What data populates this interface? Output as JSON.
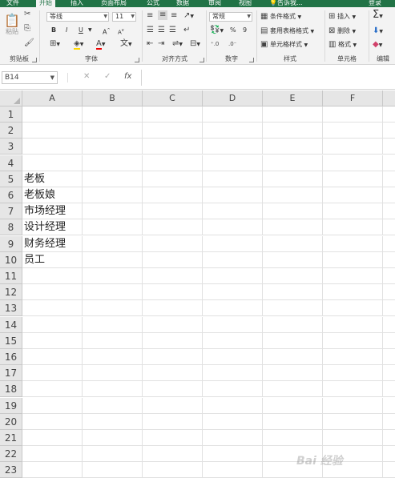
{
  "tabs": [
    "文件",
    "开始",
    "插入",
    "页面布局",
    "公式",
    "数据",
    "审阅",
    "视图",
    "告诉我...",
    "登录"
  ],
  "ribbon": {
    "clipboard": {
      "paste": "粘贴",
      "label": "剪贴板"
    },
    "font": {
      "name": "等线",
      "size": "11",
      "bold": "B",
      "italic": "I",
      "underline": "U",
      "grow": "A",
      "shrink": "A",
      "label": "字体"
    },
    "alignment": {
      "label": "对齐方式"
    },
    "number": {
      "format": "常规",
      "percent": "%",
      "comma": "9",
      "label": "数字"
    },
    "styles": {
      "conditional": "条件格式",
      "table": "套用表格格式",
      "cell": "单元格样式",
      "label": "样式"
    },
    "cells": {
      "insert": "插入",
      "delete": "删除",
      "format": "格式",
      "label": "单元格"
    },
    "editing": {
      "sum": "Σ",
      "label": "编辑"
    }
  },
  "formula_bar": {
    "name_box": "B14",
    "cancel": "✕",
    "enter": "✓",
    "fx": "fx",
    "value": ""
  },
  "columns": [
    "A",
    "B",
    "C",
    "D",
    "E",
    "F"
  ],
  "rows": [
    "1",
    "2",
    "3",
    "4",
    "5",
    "6",
    "7",
    "8",
    "9",
    "10",
    "11",
    "12",
    "13",
    "14",
    "15",
    "16",
    "17",
    "18",
    "19",
    "20",
    "21",
    "22",
    "23"
  ],
  "cells": {
    "A5": "老板",
    "A6": "老板娘",
    "A7": "市场经理",
    "A8": "设计经理",
    "A9": "财务经理",
    "A10": "员工"
  },
  "watermark": "Bai 经验"
}
